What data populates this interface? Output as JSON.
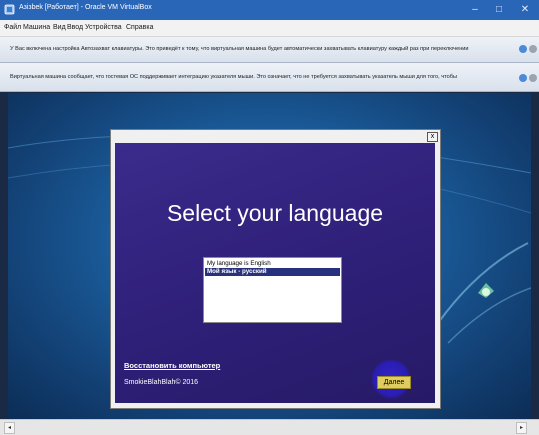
{
  "window": {
    "title": "Азізbek [Работает] - Oracle VM VirtualBox",
    "minimize": "–",
    "maximize": "□",
    "close": "✕"
  },
  "menu": [
    "Файл",
    "Машина",
    "Вид",
    "Ввод",
    "Устройства",
    "Справка"
  ],
  "notices": {
    "keyboard": "У Вас включена настройка Автозахват клавиатуры. Это приведёт к тому, что виртуальная машина будет автоматически захватывать клавиатуру каждый раз при переключении",
    "mouse": "Виртуальная машина сообщает, что гостевая ОС поддерживает интеграцию указателя мыши. Это означает, что не требуется захватывать указатель мыши для того, чтобы"
  },
  "dialog": {
    "close": "x",
    "heading": "Select your language",
    "options": [
      "My language is English",
      "Мой язык - русский"
    ],
    "selected_index": 1,
    "repair_link": "Восстановить компьютер",
    "copyright": "SmokieBlahBlah© 2016",
    "next_button": "Далее"
  },
  "colors": {
    "titlebar": "#2a66b8",
    "dialog_bg": "#2e1f78",
    "selection": "#27317d",
    "next_button": "#e0cd5f"
  }
}
